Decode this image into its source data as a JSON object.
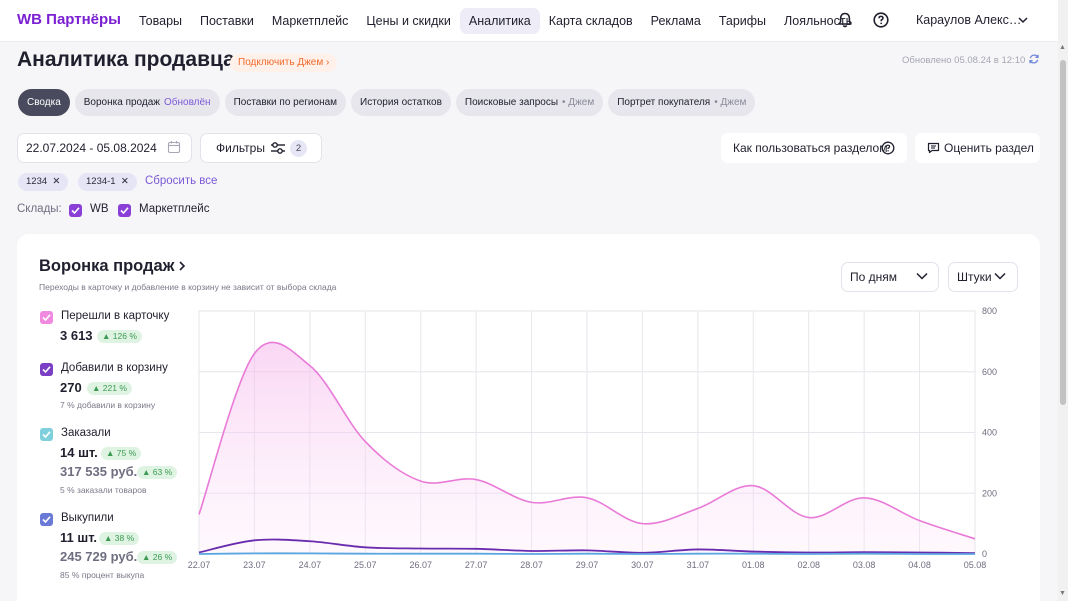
{
  "nav": {
    "logo": "WB Партнёры",
    "items": [
      "Товары",
      "Поставки",
      "Маркетплейс",
      "Цены и скидки",
      "Аналитика",
      "Карта складов",
      "Реклама",
      "Тарифы",
      "Лояльность"
    ],
    "active_item": "Аналитика",
    "user": "Караулов Алекс…"
  },
  "header": {
    "title": "Аналитика продавца",
    "jam_link": "Подключить Джем",
    "updated": "Обновлено 05.08.24 в 12:10"
  },
  "tabs": [
    {
      "label": "Сводка",
      "badge": "",
      "badge_type": ""
    },
    {
      "label": "Воронка продаж",
      "badge": "Обновлён",
      "badge_type": "blue"
    },
    {
      "label": "Поставки по регионам",
      "badge": "",
      "badge_type": ""
    },
    {
      "label": "История остатков",
      "badge": "",
      "badge_type": ""
    },
    {
      "label": "Поисковые запросы",
      "badge": "• Джем",
      "badge_type": "gray"
    },
    {
      "label": "Портрет покупателя",
      "badge": "• Джем",
      "badge_type": "gray"
    }
  ],
  "filters": {
    "date_range": "22.07.2024 - 05.08.2024",
    "filters_label": "Фильтры",
    "filters_count": "2",
    "howto_label": "Как пользоваться разделом",
    "rate_label": "Оценить раздел",
    "chips": [
      "1234",
      "1234-1"
    ],
    "reset_label": "Сбросить все"
  },
  "warehouses": {
    "label": "Склады:",
    "items": [
      "WB",
      "Маркетплейс"
    ]
  },
  "funnel": {
    "title": "Воронка продаж",
    "subtitle": "Переходы в карточку и добавление в корзину не зависит от выбора склада",
    "period_select": "По дням",
    "unit_select": "Штуки"
  },
  "metrics": [
    {
      "label": "Перешли в карточку",
      "value": "3 613",
      "change": "126 %",
      "note": "",
      "color": "#f08ae0"
    },
    {
      "label": "Добавили в корзину",
      "value": "270",
      "change": "221 %",
      "note": "7 % добавили в корзину",
      "color": "#7a3fc4"
    },
    {
      "label": "Заказали",
      "value": "14 шт.",
      "change": "75 %",
      "value2": "317 535 руб.",
      "change2": "63 %",
      "note": "5 % заказали товаров",
      "color": "#7fd0dc"
    },
    {
      "label": "Выкупили",
      "value": "11 шт.",
      "change": "38 %",
      "value2": "245 729 руб.",
      "change2": "26 %",
      "note": "85 % процент выкупа",
      "color": "#6a7ad6"
    }
  ],
  "colors": {
    "accent": "#7b1fd3",
    "clicks": "#e97ad8",
    "cart": "#6a2cae",
    "orders": "#5aa6e0"
  },
  "chart_data": {
    "type": "area",
    "x": [
      "22.07",
      "23.07",
      "24.07",
      "25.07",
      "26.07",
      "27.07",
      "28.07",
      "29.07",
      "30.07",
      "31.07",
      "01.08",
      "02.08",
      "03.08",
      "04.08",
      "05.08"
    ],
    "series": [
      {
        "name": "Перешли в карточку",
        "values": [
          130,
          660,
          620,
          370,
          240,
          245,
          170,
          185,
          100,
          150,
          225,
          120,
          185,
          110,
          50
        ]
      },
      {
        "name": "Добавили в корзину",
        "values": [
          5,
          45,
          42,
          22,
          18,
          17,
          10,
          12,
          4,
          15,
          8,
          5,
          6,
          5,
          3
        ]
      },
      {
        "name": "Заказали",
        "values": [
          0,
          2,
          2,
          1,
          1,
          1,
          0,
          1,
          0,
          1,
          1,
          0,
          1,
          0,
          0
        ]
      }
    ],
    "y_ticks": [
      "800",
      "600",
      "400",
      "200",
      "0"
    ],
    "ylim": [
      0,
      800
    ],
    "grid": true
  }
}
